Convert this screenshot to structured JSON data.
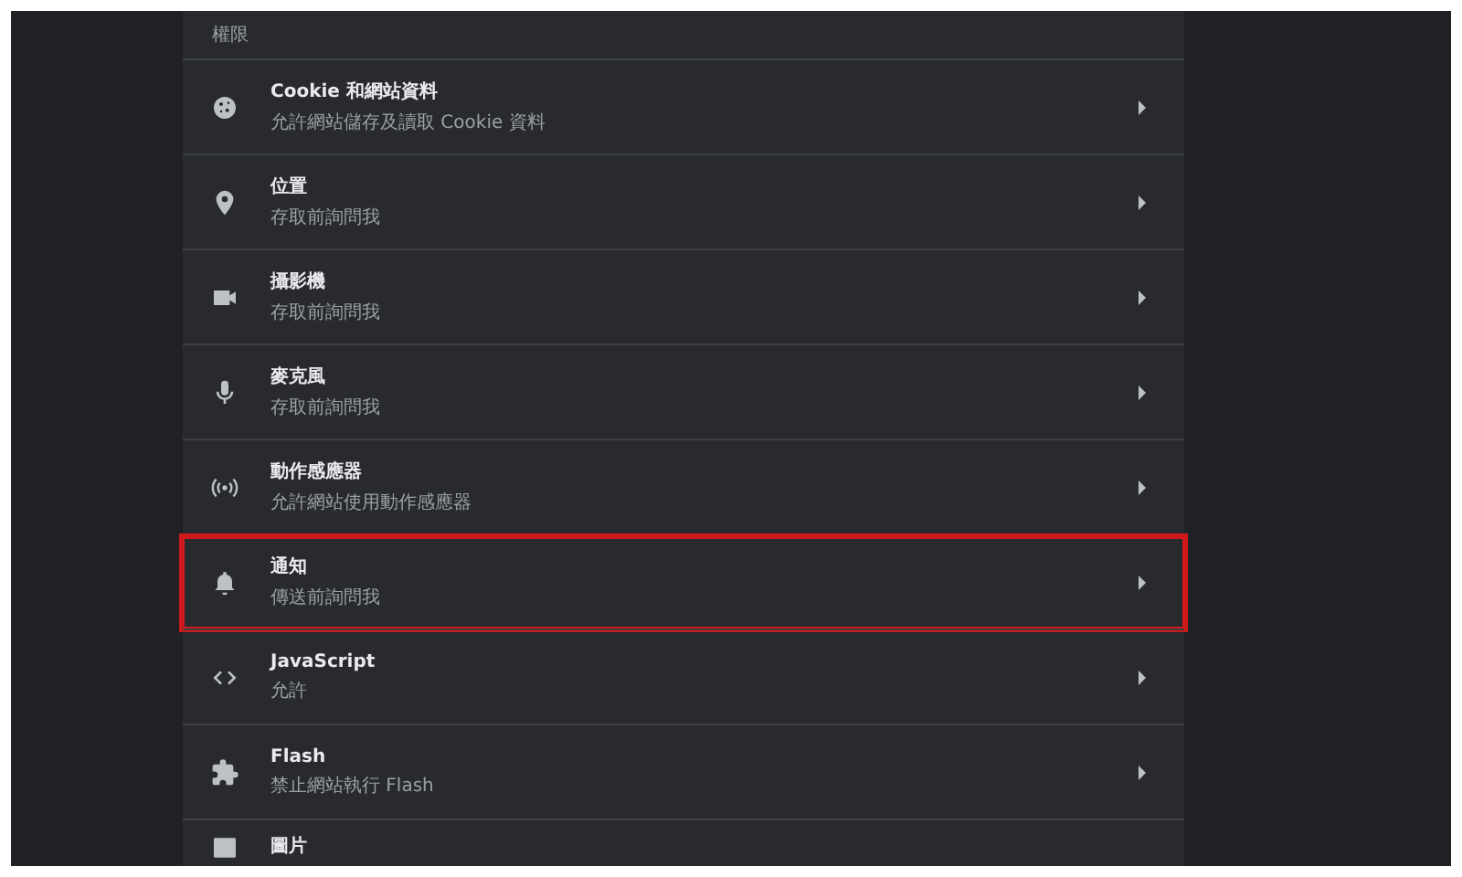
{
  "section": {
    "title": "權限"
  },
  "rows": [
    {
      "title": "Cookie 和網站資料",
      "subtitle": "允許網站儲存及讀取 Cookie 資料",
      "highlighted": false
    },
    {
      "title": "位置",
      "subtitle": "存取前詢問我",
      "highlighted": false
    },
    {
      "title": "攝影機",
      "subtitle": "存取前詢問我",
      "highlighted": false
    },
    {
      "title": "麥克風",
      "subtitle": "存取前詢問我",
      "highlighted": false
    },
    {
      "title": "動作感應器",
      "subtitle": "允許網站使用動作感應器",
      "highlighted": false
    },
    {
      "title": "通知",
      "subtitle": "傳送前詢問我",
      "highlighted": true
    },
    {
      "title": "JavaScript",
      "subtitle": "允許",
      "highlighted": false
    },
    {
      "title": "Flash",
      "subtitle": "禁止網站執行 Flash",
      "highlighted": false
    },
    {
      "title": "圖片",
      "highlighted": false
    }
  ]
}
